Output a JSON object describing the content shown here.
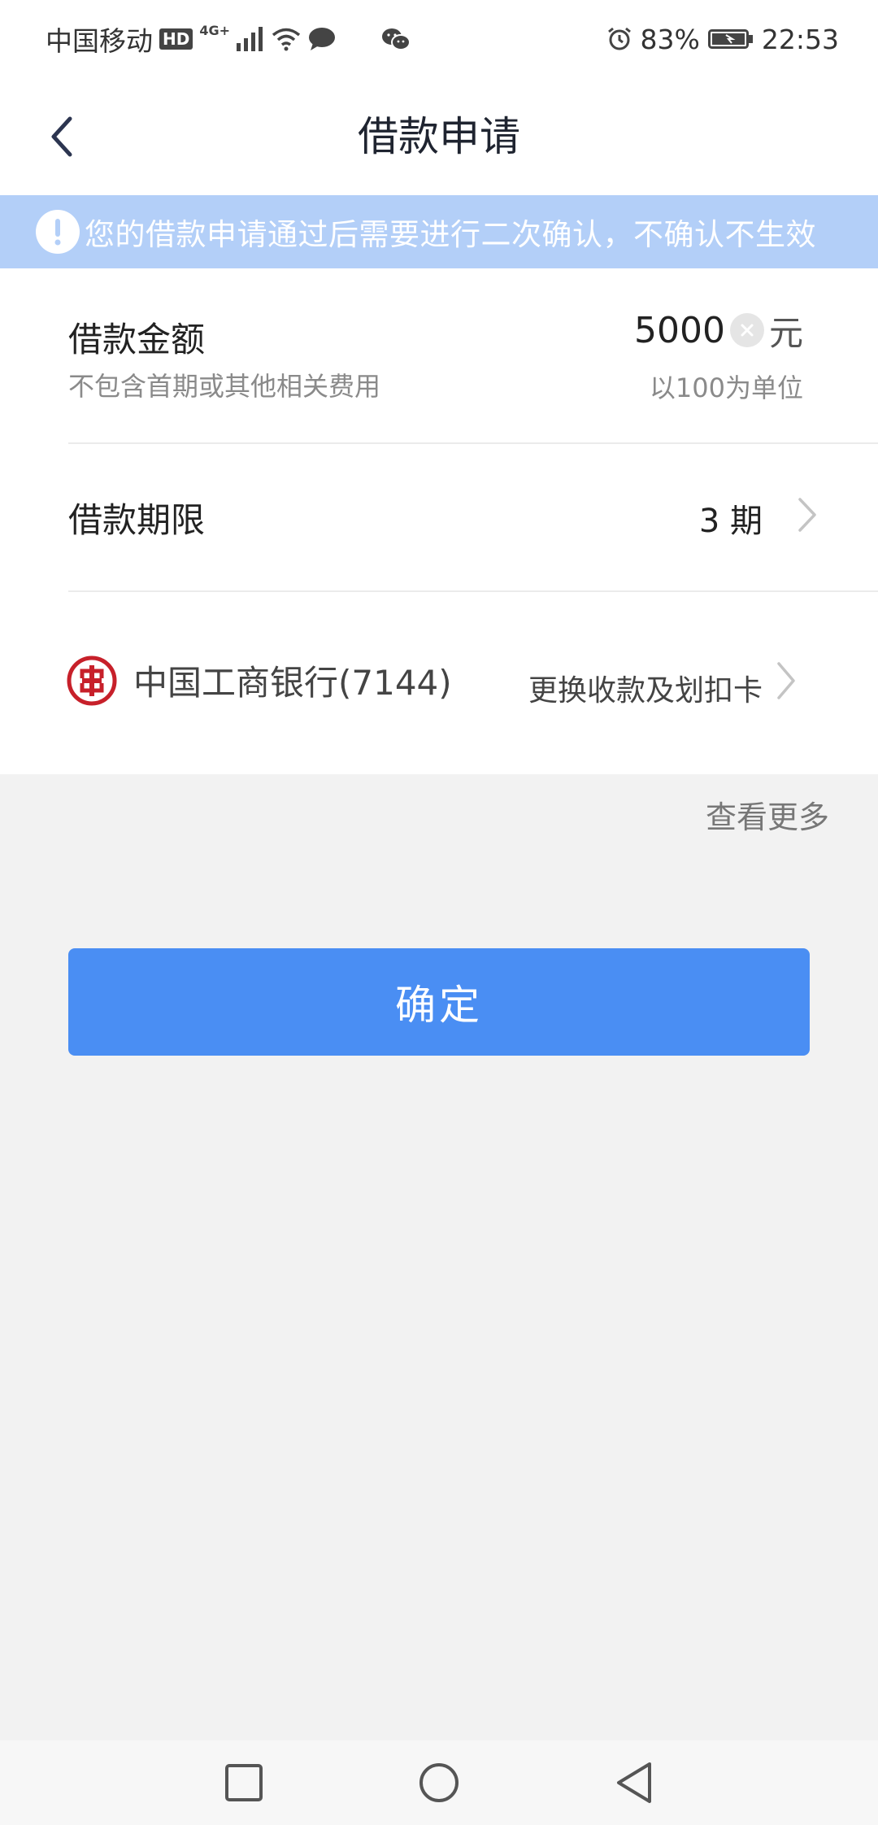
{
  "status_bar": {
    "carrier": "中国移动",
    "hd_label": "HD",
    "network_type": "4G+",
    "battery_percent": "83%",
    "time": "22:53",
    "icons": [
      "signal-icon",
      "wifi-icon",
      "chat-bubble-icon",
      "wechat-icon",
      "alarm-icon",
      "battery-icon"
    ]
  },
  "header": {
    "title": "借款申请",
    "back_icon": "chevron-left-icon"
  },
  "notice": {
    "text": "您的借款申请通过后需要进行二次确认，不确认不生效",
    "icon": "exclamation-icon"
  },
  "loan_amount": {
    "label": "借款金额",
    "hint": "不包含首期或其他相关费用",
    "value": "5000",
    "unit": "元",
    "rule": "以100为单位"
  },
  "loan_term": {
    "label": "借款期限",
    "value": "3 期"
  },
  "bank": {
    "name": "中国工商银行(7144)",
    "change_label": "更换收款及划扣卡",
    "brand_color": "#c7202a"
  },
  "view_more": "查看更多",
  "confirm_button": "确定",
  "colors": {
    "accent": "#4a8ef3",
    "notice_bg": "#b3cff8",
    "page_bg": "#f2f2f2"
  },
  "nav_bar": {
    "icons": [
      "recent-apps-icon",
      "home-icon",
      "back-icon"
    ]
  }
}
